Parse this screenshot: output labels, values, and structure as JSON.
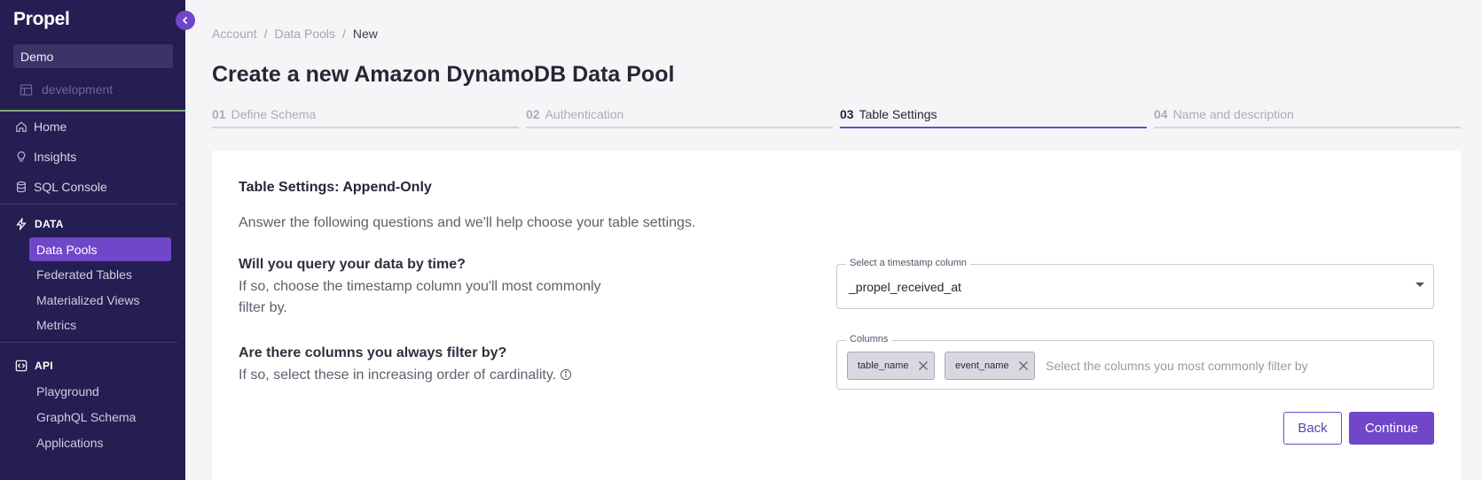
{
  "app": {
    "brand": "Propel",
    "org": "Demo",
    "environment": "development"
  },
  "nav": {
    "main": [
      {
        "label": "Home",
        "icon": "home-icon"
      },
      {
        "label": "Insights",
        "icon": "lightbulb-icon"
      },
      {
        "label": "SQL Console",
        "icon": "database-icon"
      }
    ],
    "data_section": "DATA",
    "data_items": [
      "Data Pools",
      "Federated Tables",
      "Materialized Views",
      "Metrics"
    ],
    "api_section": "API",
    "api_items": [
      "Playground",
      "GraphQL Schema",
      "Applications"
    ]
  },
  "breadcrumb": [
    "Account",
    "Data Pools",
    "New"
  ],
  "page": {
    "title": "Create a new Amazon DynamoDB Data Pool"
  },
  "steps": [
    {
      "num": "01",
      "label": "Define Schema"
    },
    {
      "num": "02",
      "label": "Authentication"
    },
    {
      "num": "03",
      "label": "Table Settings"
    },
    {
      "num": "04",
      "label": "Name and description"
    }
  ],
  "card": {
    "title": "Table Settings: Append-Only",
    "intro": "Answer the following questions and we'll help choose your table settings.",
    "q1": {
      "title": "Will you query your data by time?",
      "desc": "If so, choose the timestamp column you'll most commonly filter by.",
      "field_label": "Select a timestamp column",
      "value": "_propel_received_at"
    },
    "q2": {
      "title": "Are there columns you always filter by?",
      "desc": "If so, select these in increasing order of cardinality.",
      "field_label": "Columns",
      "chips": [
        "table_name",
        "event_name"
      ],
      "placeholder": "Select the columns you most commonly filter by"
    },
    "back_label": "Back",
    "continue_label": "Continue"
  },
  "colors": {
    "sidebar": "#251e52",
    "accent": "#7047c9",
    "env_line": "#7aa86b"
  }
}
